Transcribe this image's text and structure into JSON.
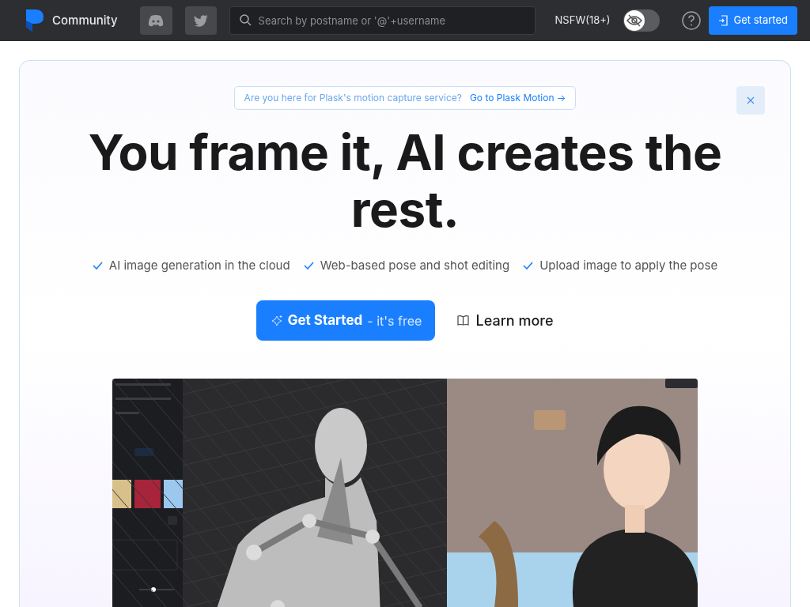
{
  "header": {
    "brand": "Community",
    "search": {
      "placeholder": "Search by postname or '@'+username"
    },
    "nsfw": {
      "label": "NSFW(18+)",
      "on": false
    },
    "cta": "Get started"
  },
  "banner": {
    "text": "Are you here for Plask's motion capture service?",
    "link": "Go to Plask Motion →"
  },
  "hero": {
    "title": "You frame it, AI creates the rest.",
    "features": [
      "AI image generation in the cloud",
      "Web-based pose and shot editing",
      "Upload image to apply the pose"
    ],
    "primary": {
      "bold": "Get Started",
      "rest": "- it's free"
    },
    "secondary": "Learn more"
  }
}
